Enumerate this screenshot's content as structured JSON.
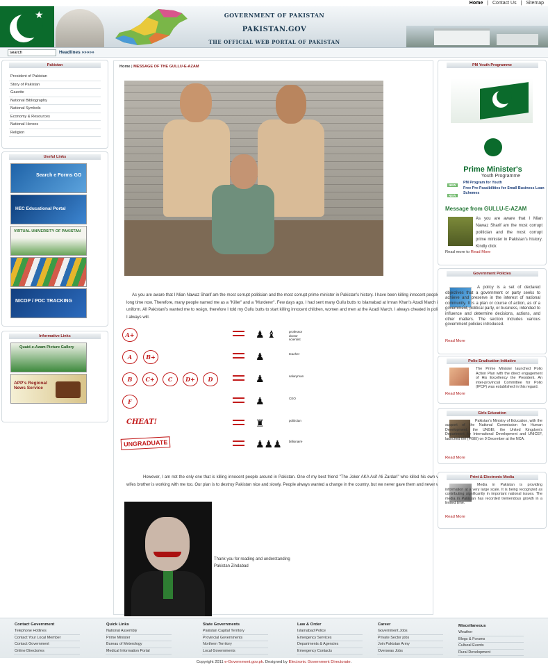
{
  "toplinks": {
    "home": "Home",
    "sep1": "|",
    "contact": "Contact Us",
    "sep2": "|",
    "sitemap": "Sitemap"
  },
  "header": {
    "line1": "GOVERNMENT OF PAKISTAN",
    "line2": "PAKISTAN.GOV",
    "line3": "THE OFFICIAL WEB PORTAL OF PAKISTAN"
  },
  "search": {
    "value": "search",
    "headlines": "Headlines »»»»»"
  },
  "left": {
    "pakistan_title": "Pakistan",
    "pakistan_items": [
      "President of Pakistan",
      "Story of Pakistan",
      "Gazette",
      "National Bibliography",
      "National Symbols",
      "Economy & Resources",
      "National Heroes",
      "Religion"
    ],
    "useful_title": "Useful Links",
    "useful_banners": [
      "Search e Forms GO",
      "HEC Educational Portal",
      "VIRTUAL UNIVERSITY OF PAKISTAN",
      "",
      "NICOP / POC TRACKING"
    ],
    "informative_title": "Informative Links",
    "informative_banners": [
      "Quaid-e-Azam Picture Gallery",
      "APP's Regional News Service"
    ]
  },
  "main": {
    "crumb_home": "Home",
    "crumb_sep": " | ",
    "crumb_page": "MESSAGE OF THE GULLU-E-AZAM",
    "para1": "As you are aware that I Mian Nawaz Sharif am the most corrupt politician and the most corrupt prime minister in Pakistan's history. I have been killing innocent people from a long time now. Therefore, many people named me as a \"Killer\" and a \"Murderer\". Few days ago, I had sent many Gullu butts to Islamabad at Imran Khan's Azadi March in police uniform. All Pakistani's wanted me to resign, therefore I told my Gullu butts to start killing innocent children, women and men at the Azadi March. I always cheated in politics and I always will.",
    "para2": "However, I am not the only one that is killing innocent people around in Pakistan. One of my best friend \"The Joker AKA Asif Ali Zardari\" who killed his own wife and wifes brother is working with me too. Our plan is to destroy Pakistan nice and slowly. People always wanted a change in the country, but we never gave them and never will !",
    "thanks1": "Thank you for reading and understanding",
    "thanks2": "Pakistan Zindabad",
    "grades": [
      {
        "circles": [
          "A+"
        ],
        "label": "professor\ndoctor\nscientist"
      },
      {
        "circles": [
          "A",
          "B+"
        ],
        "label": "teacher"
      },
      {
        "circles": [
          "B",
          "C+",
          "C",
          "D+",
          "D"
        ],
        "label": "salaryman"
      },
      {
        "circles": [
          "F"
        ],
        "label": "CEO"
      },
      {
        "text": "CHEAT!",
        "label": "politician"
      },
      {
        "text": "UNGRADUATE",
        "label": "billionaire"
      }
    ]
  },
  "right": {
    "pm_title": "PM Youth Programme",
    "pm_logo1": "Prime Minister's",
    "pm_logo2": "Youth Programme",
    "new1": "NEW",
    "pm_link1": "PM Program for Youth",
    "new2": "NEW",
    "pm_link2": "Free Pre-Feasibilities for Small Business Loan Schemes",
    "msg_heading": "Message from GULLU-E-AZAM",
    "msg_text": "As you are aware that I Mian Nawaz Sharif am the most corrupt politician and the most corrupt prime minister in Pakistan's history. Kindly click",
    "msg_more_pre": "Read more to ",
    "msg_more": "Read More",
    "gov_title": "Government Policies",
    "gov_text": "A policy is a set of declared objectives that a government or party seeks to achieve and preserve in the interest of national community. It is a plan or course of action, as of a government, political party, or business, intended to influence and determine decisions, actions, and other matters. The section includes various government policies introduced.",
    "gov_more": "Read More",
    "polio_title": "Polio Eradication Initiative",
    "polio_text": "The Prime Minister launched Polio Action Plan with the direct engagement of His Excellency the President. An inter-provincial Committee for Polio (IPCP) was established in this regard.",
    "polio_more": "Read More",
    "girls_title": "Girls Education",
    "girls_text": "Pakistan's Ministry of Education, with the support of the National Commission for Human Development, the UNGEI, the United Kingdom's Department for International Development and UNICEF, launched the (PGEI) on 9 December at the NCA.",
    "girls_more": "Read More",
    "media_title": "Print & Electronic Media",
    "media_text": "Media in Pakistan is providing information at a very large scale. It is being recognized as contributing significantly in important national issues. The media in Pakistan has recorded tremendous growth in a limited time.",
    "media_more": "Read More"
  },
  "footer": {
    "cols": [
      {
        "head": "Contact Government",
        "items": [
          "Telephone Hotlines",
          "Contact Your Local Member",
          "Contact Government",
          "Online Directories"
        ]
      },
      {
        "head": "Quick Links",
        "items": [
          "National Assembly",
          "Prime Minister",
          "Bureau of Meterology",
          "Medical Information Portal"
        ]
      },
      {
        "head": "State Governments",
        "items": [
          "Pakistan Capital Territory",
          "Provincial Governments",
          "Northern Territory",
          "Local Governments"
        ]
      },
      {
        "head": "Law & Order",
        "items": [
          "Islamabad Police",
          "Emergency Services",
          "Departments & Agencies",
          "Emergency Contacts"
        ]
      },
      {
        "head": "Career",
        "items": [
          "Government Jobs",
          "Private Sector jobs",
          "Join Pakistan Army",
          "Overseas Jobs"
        ]
      },
      {
        "head": "Miscellaneous",
        "items": [
          "Weather",
          "Blogs & Forums",
          "Cultural Events",
          "Rural Development"
        ]
      }
    ],
    "copy_pre": "Copyright 2011 ",
    "copy_site": "e-Government.gov.pk",
    "copy_mid": ". Designed by ",
    "copy_designer": "Electronic Government Directorate",
    "copy_end": "."
  },
  "colors": {
    "accent": "#8c1a1a",
    "green": "#0b6b2c",
    "link": "#b01c1c"
  }
}
